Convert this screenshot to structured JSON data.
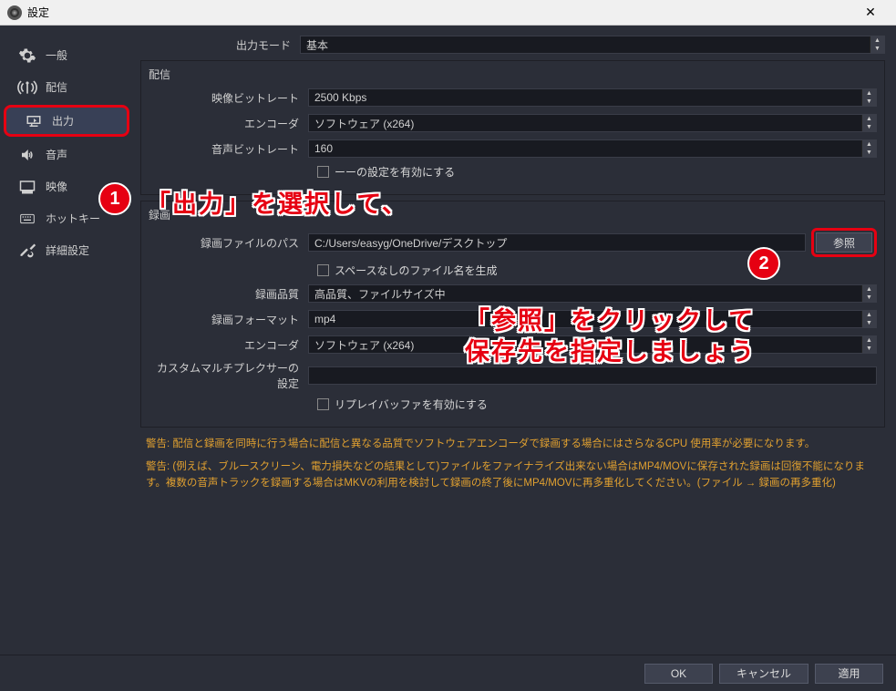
{
  "window": {
    "title": "設定"
  },
  "sidebar": {
    "items": [
      {
        "label": "一般"
      },
      {
        "label": "配信"
      },
      {
        "label": "出力"
      },
      {
        "label": "音声"
      },
      {
        "label": "映像"
      },
      {
        "label": "ホットキー"
      },
      {
        "label": "詳細設定"
      }
    ]
  },
  "output_mode": {
    "label": "出力モード",
    "value": "基本"
  },
  "streaming": {
    "title": "配信",
    "video_bitrate": {
      "label": "映像ビットレート",
      "value": "2500 Kbps"
    },
    "encoder": {
      "label": "エンコーダ",
      "value": "ソフトウェア (x264)"
    },
    "audio_bitrate": {
      "label": "音声ビットレート",
      "value": "160"
    },
    "advanced_enable": "ーーの設定を有効にする"
  },
  "recording": {
    "title": "録画",
    "path": {
      "label": "録画ファイルのパス",
      "value": "C:/Users/easyg/OneDrive/デスクトップ"
    },
    "browse": "参照",
    "no_space": "スペースなしのファイル名を生成",
    "quality": {
      "label": "録画品質",
      "value": "高品質、ファイルサイズ中"
    },
    "format": {
      "label": "録画フォーマット",
      "value": "mp4"
    },
    "encoder": {
      "label": "エンコーダ",
      "value": "ソフトウェア (x264)"
    },
    "muxer": {
      "label": "カスタムマルチプレクサーの設定",
      "value": ""
    },
    "replay": "リプレイバッファを有効にする"
  },
  "warnings": {
    "w1": "警告: 配信と録画を同時に行う場合に配信と異なる品質でソフトウェアエンコーダで録画する場合にはさらなるCPU 使用率が必要になります。",
    "w2": "警告: (例えば、ブルースクリーン、電力損失などの結果として)ファイルをファイナライズ出来ない場合はMP4/MOVに保存された録画は回復不能になります。複数の音声トラックを録画する場合はMKVの利用を検討して録画の終了後にMP4/MOVに再多重化してください。(ファイル → 録画の再多重化)"
  },
  "footer": {
    "ok": "OK",
    "cancel": "キャンセル",
    "apply": "適用"
  },
  "annotations": {
    "badge1": "1",
    "badge2": "2",
    "text1": "「出力」を選択して、",
    "text2": "「参照」をクリックして\n保存先を指定しましょう"
  }
}
